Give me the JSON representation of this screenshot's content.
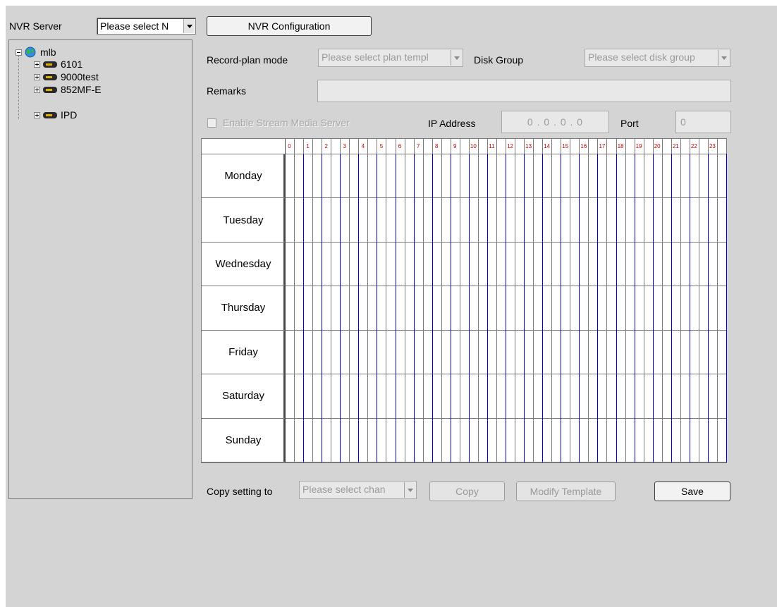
{
  "top": {
    "server_label": "NVR Server",
    "server_select": "Please select N",
    "config_button": "NVR Configuration"
  },
  "tree": {
    "root": "mlb",
    "children": [
      "6101",
      "9000test",
      "852MF-E",
      "IPD"
    ]
  },
  "form": {
    "record_plan_label": "Record-plan mode",
    "record_plan_select": "Please select plan templ",
    "disk_group_label": "Disk Group",
    "disk_group_select": "Please select disk group",
    "remarks_label": "Remarks",
    "remarks_value": "",
    "stream_checkbox_label": "Enable Stream Media Server",
    "stream_checked": false,
    "ip_label": "IP Address",
    "ip_value": "0 . 0 . 0 . 0",
    "port_label": "Port",
    "port_value": "0"
  },
  "schedule": {
    "hours": [
      "0",
      "1",
      "2",
      "3",
      "4",
      "5",
      "6",
      "7",
      "8",
      "9",
      "10",
      "11",
      "12",
      "13",
      "14",
      "15",
      "16",
      "17",
      "18",
      "19",
      "20",
      "21",
      "22",
      "23"
    ],
    "days": [
      "Monday",
      "Tuesday",
      "Wednesday",
      "Thursday",
      "Friday",
      "Saturday",
      "Sunday"
    ],
    "hour_line_color": "#0000c8",
    "minor_line_color": "#7a7a7a"
  },
  "bottom": {
    "copy_label": "Copy setting to",
    "channel_select": "Please select chan",
    "copy_button": "Copy",
    "modify_button": "Modify Template",
    "save_button": "Save"
  }
}
